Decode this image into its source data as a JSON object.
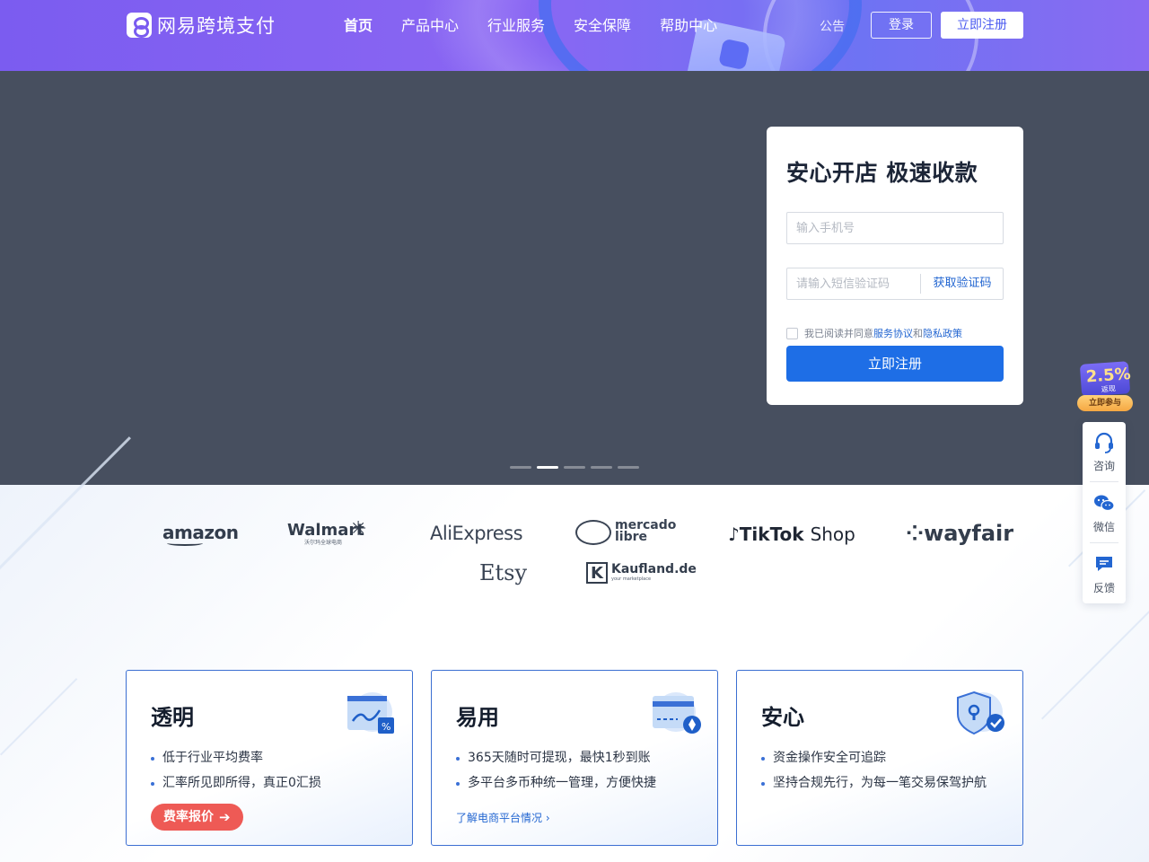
{
  "header": {
    "logo_text": "网易跨境支付",
    "nav": [
      {
        "label": "首页",
        "active": true
      },
      {
        "label": "产品中心",
        "active": false
      },
      {
        "label": "行业服务",
        "active": false
      },
      {
        "label": "安全保障",
        "active": false
      },
      {
        "label": "帮助中心",
        "active": false
      }
    ],
    "notice": "公告",
    "login": "登录",
    "register": "立即注册"
  },
  "register_card": {
    "title": "安心开店 极速收款",
    "phone_placeholder": "输入手机号",
    "code_placeholder": "请输入短信验证码",
    "get_code": "获取验证码",
    "agree_prefix": "我已阅读并同意",
    "agree_service": "服务协议",
    "agree_and": "和",
    "agree_privacy": "隐私政策",
    "submit": "立即注册"
  },
  "carousel": {
    "slides": 5,
    "active_index": 1
  },
  "brands": {
    "amazon": "amazon",
    "walmart": "Walmart",
    "walmart_sub": "沃尔玛全球电商",
    "aliexpress": "AliExpress",
    "mercado_1": "mercado",
    "mercado_2": "libre",
    "tiktok": "TikTok",
    "tiktok_shop": "Shop",
    "wayfair": "wayfair",
    "etsy": "Etsy",
    "kaufland": "Kaufland.de",
    "kaufland_sub": "your marketplace"
  },
  "features": [
    {
      "title": "透明",
      "points": [
        "低于行业平均费率",
        "汇率所见即所得，真正0汇损"
      ],
      "action": "费率报价"
    },
    {
      "title": "易用",
      "points": [
        "365天随时可提现，最快1秒到账",
        "多平台多币种统一管理，方便快捷"
      ],
      "action": "了解电商平台情况 ›"
    },
    {
      "title": "安心",
      "points": [
        "资金操作安全可追踪",
        "坚持合规先行，为每一笔交易保驾护航"
      ]
    }
  ],
  "promo": {
    "percent": "2.5%",
    "sub": "返现",
    "button": "立即参与"
  },
  "sidebar": {
    "consult": "咨询",
    "wechat": "微信",
    "feedback": "反馈"
  },
  "colors": {
    "header_purple": "#7b5cf0",
    "primary_blue": "#1e6ee6",
    "hero_bg": "#474f5f",
    "rate_button": "#ee5a55"
  }
}
